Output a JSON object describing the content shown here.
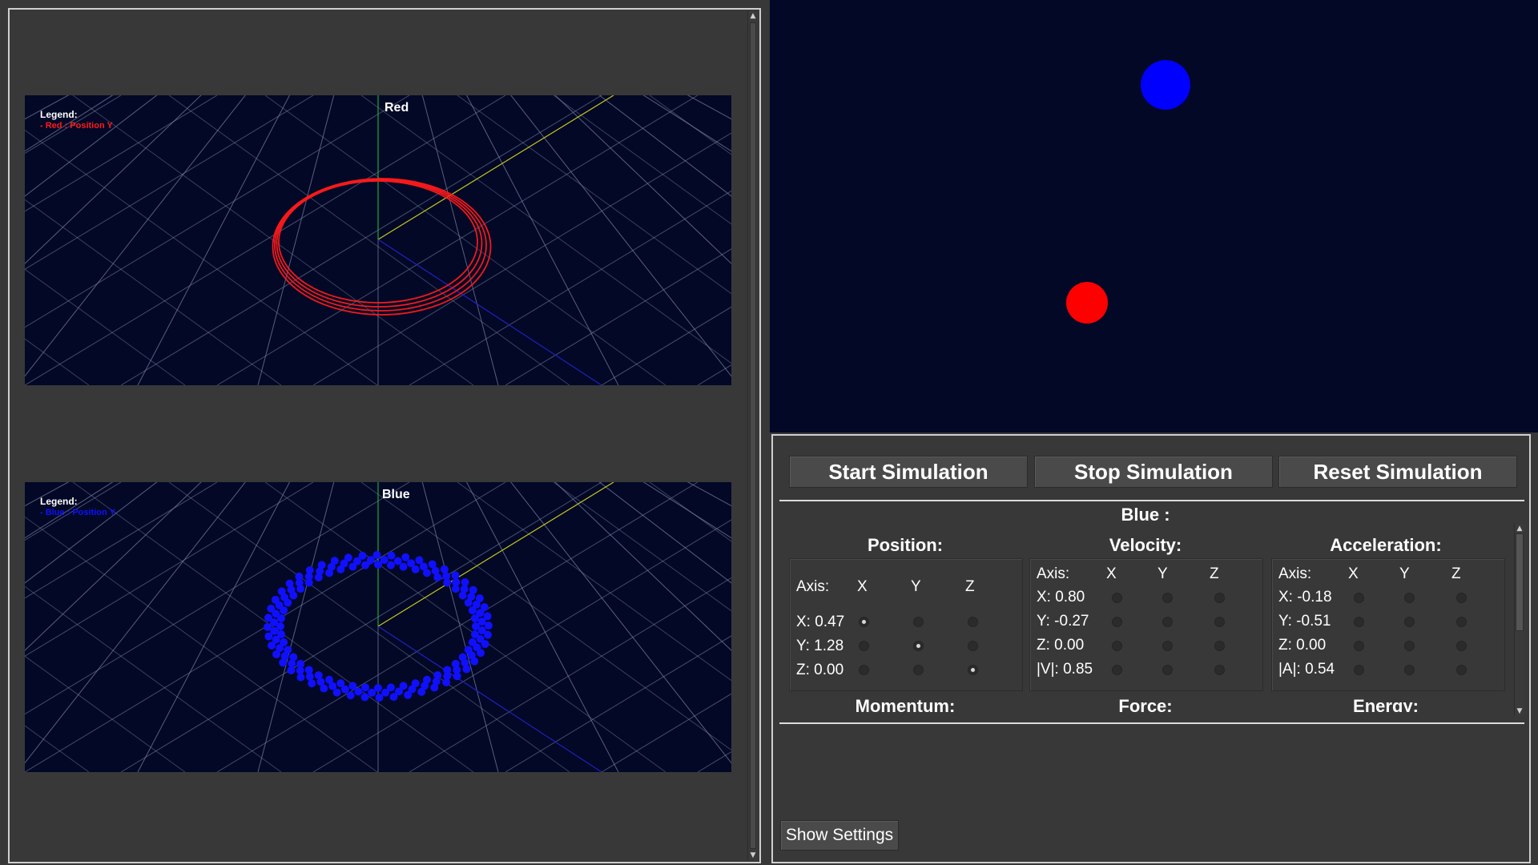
{
  "plots": [
    {
      "title": "Red",
      "legend_heading": "Legend:",
      "legend_item": "- Red : Position Y",
      "color": "#ff1a1a",
      "style": "rings"
    },
    {
      "title": "Blue",
      "legend_heading": "Legend:",
      "legend_item": "- Blue : Position Y",
      "color": "#1010ff",
      "style": "dots"
    }
  ],
  "simulation": {
    "background": "#020826",
    "balls": [
      {
        "name": "blue",
        "color": "#0000ff"
      },
      {
        "name": "red",
        "color": "#ff0000"
      }
    ]
  },
  "controls": {
    "start_label": "Start Simulation",
    "stop_label": "Stop Simulation",
    "reset_label": "Reset Simulation",
    "body_title": "Blue :",
    "show_settings_label": "Show Settings"
  },
  "position": {
    "title": "Position:",
    "axis_label": "Axis:",
    "cols": [
      "X",
      "Y",
      "Z"
    ],
    "rows": [
      "X: 0.47",
      "Y: 1.28",
      "Z: 0.00"
    ],
    "selected": [
      0,
      1,
      2
    ]
  },
  "velocity": {
    "title": "Velocity:",
    "axis_label": "Axis:",
    "cols": [
      "X",
      "Y",
      "Z"
    ],
    "rows": [
      "X: 0.80",
      "Y: -0.27",
      "Z: 0.00",
      "|V|: 0.85"
    ]
  },
  "acceleration": {
    "title": "Acceleration:",
    "axis_label": "Axis:",
    "cols": [
      "X",
      "Y",
      "Z"
    ],
    "rows": [
      "X: -0.18",
      "Y: -0.51",
      "Z: 0.00",
      "|A|: 0.54"
    ]
  },
  "next_sections": [
    "Momentum:",
    "Force:",
    "Energy:"
  ]
}
